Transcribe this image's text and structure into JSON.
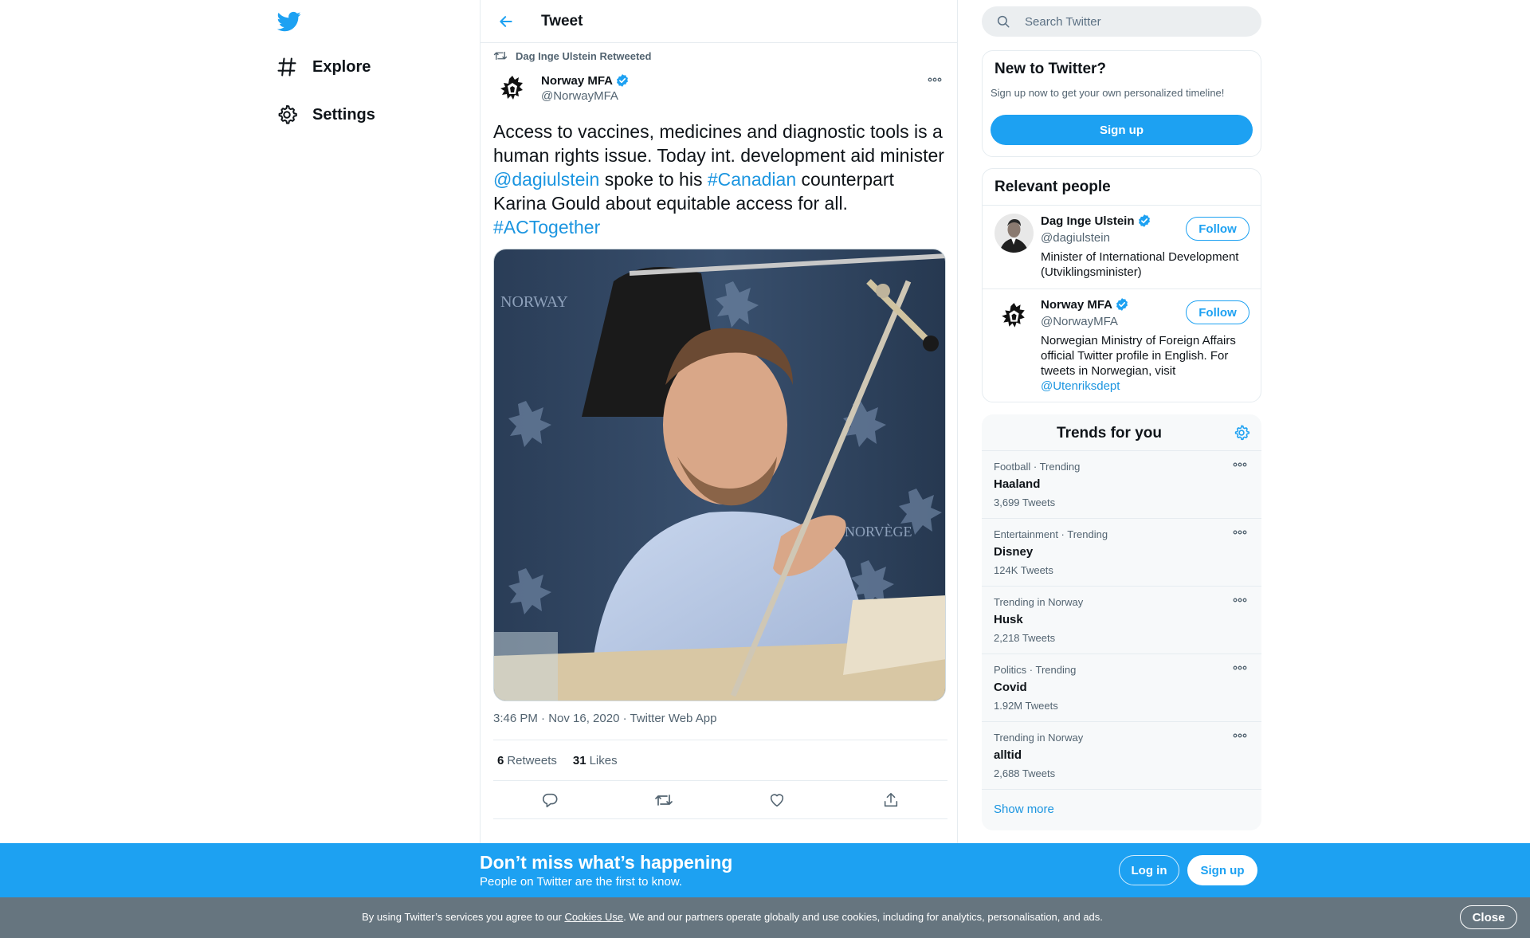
{
  "nav": {
    "items": [
      {
        "label": "Explore",
        "icon": "hashtag-icon"
      },
      {
        "label": "Settings",
        "icon": "gear-icon"
      }
    ]
  },
  "colors": {
    "accent": "#1da1f2",
    "link": "#1b95e0",
    "cookie_bar": "#66757f",
    "text_secondary": "#536471"
  },
  "tweet": {
    "header_title": "Tweet",
    "retweeted_by": "Dag Inge Ulstein Retweeted",
    "author_name": "Norway MFA",
    "author_handle": "@NorwayMFA",
    "text_parts": [
      {
        "text": "Access to vaccines, medicines and diagnostic tools is a human rights issue. Today int. development aid minister ",
        "link": false
      },
      {
        "text": "@dagiulstein",
        "link": true
      },
      {
        "text": " spoke to his ",
        "link": false
      },
      {
        "text": "#Canadian",
        "link": true
      },
      {
        "text": " counterpart Karina Gould about equitable access for all. ",
        "link": false
      },
      {
        "text": "#ACTogether",
        "link": true
      }
    ],
    "media_watermark_1": "NORWAY",
    "media_watermark_2": "NORVÈGE",
    "timestamp": "3:46 PM · Nov 16, 2020 · Twitter Web App",
    "retweets_count": "6",
    "retweets_label": "Retweets",
    "likes_count": "31",
    "likes_label": "Likes"
  },
  "search": {
    "placeholder": "Search Twitter"
  },
  "new_to_twitter": {
    "title": "New to Twitter?",
    "subtitle": "Sign up now to get your own personalized timeline!",
    "signup_label": "Sign up"
  },
  "relevant_people": {
    "title": "Relevant people",
    "people": [
      {
        "name": "Dag Inge Ulstein",
        "handle": "@dagiulstein",
        "bio": "Minister of International Development (Utviklingsminister)",
        "bio_link": "",
        "follow_label": "Follow"
      },
      {
        "name": "Norway MFA",
        "handle": "@NorwayMFA",
        "bio": "Norwegian Ministry of Foreign Affairs official Twitter profile in English. For tweets in Norwegian, visit ",
        "bio_link": "@Utenriksdept",
        "follow_label": "Follow"
      }
    ]
  },
  "trends": {
    "title": "Trends for you",
    "items": [
      {
        "context": "Football · Trending",
        "name": "Haaland",
        "count": "3,699 Tweets"
      },
      {
        "context": "Entertainment · Trending",
        "name": "Disney",
        "count": "124K Tweets"
      },
      {
        "context": "Trending in Norway",
        "name": "Husk",
        "count": "2,218 Tweets"
      },
      {
        "context": "Politics · Trending",
        "name": "Covid",
        "count": "1.92M Tweets"
      },
      {
        "context": "Trending in Norway",
        "name": "alltid",
        "count": "2,688 Tweets"
      }
    ],
    "show_more": "Show more"
  },
  "bottom_bar": {
    "title": "Don’t miss what’s happening",
    "subtitle": "People on Twitter are the first to know.",
    "login_label": "Log in",
    "signup_label": "Sign up"
  },
  "cookie_bar": {
    "text_before": "By using Twitter’s services you agree to our ",
    "link": "Cookies Use",
    "text_after": ". We and our partners operate globally and use cookies, including for analytics, personalisation, and ads.",
    "close_label": "Close"
  }
}
